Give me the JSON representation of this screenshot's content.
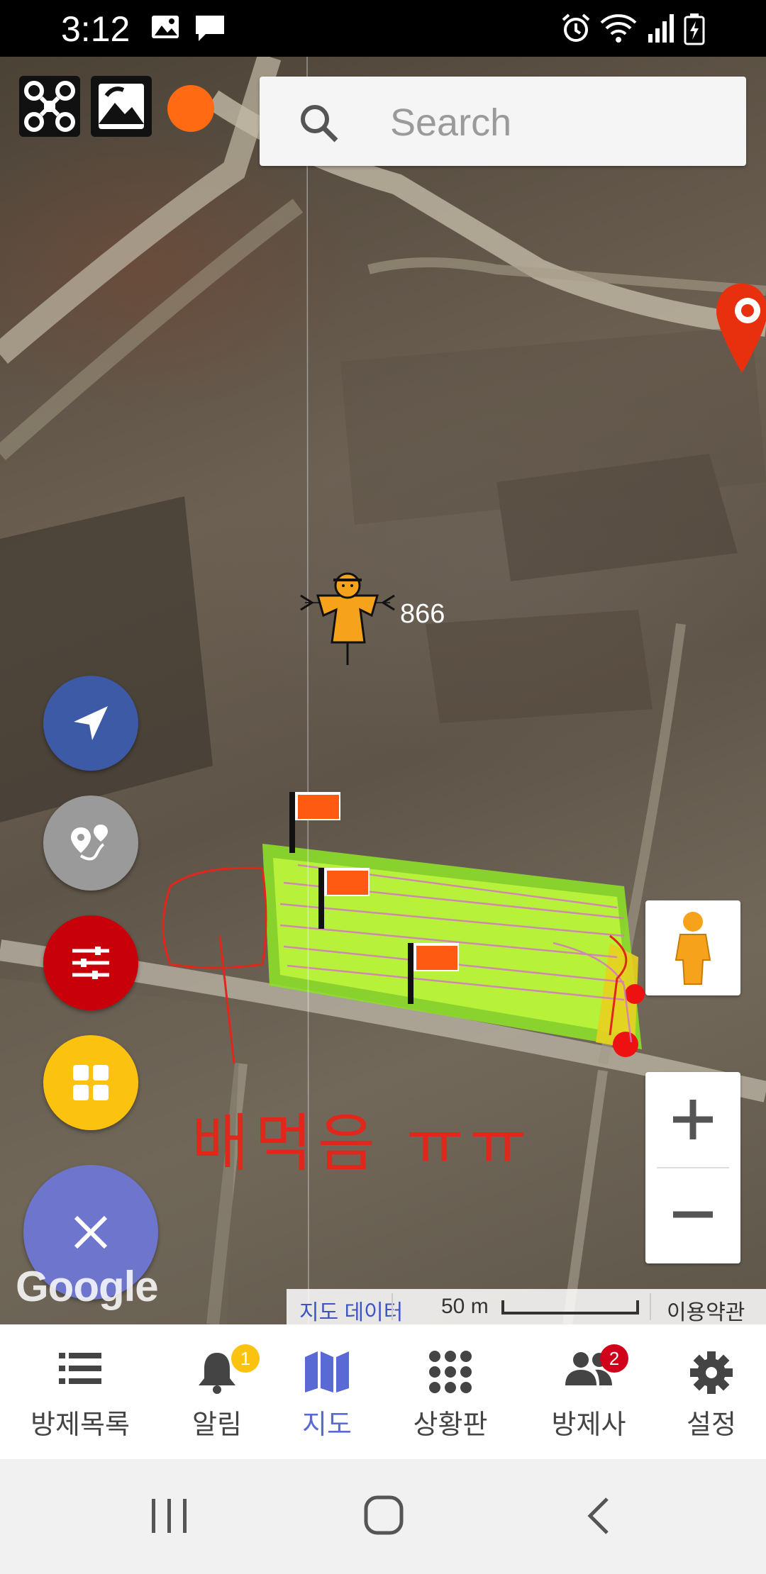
{
  "status": {
    "time": "3:12"
  },
  "search": {
    "placeholder": "Search"
  },
  "map": {
    "marker_value": "866",
    "handwritten_note": "배먹음 ㅠㅠ",
    "attribution": "Google",
    "map_data_label": "지도 데이터",
    "scale_label": "50 m",
    "terms_label": "이용약관",
    "status_dot_color": "#ff6a13"
  },
  "bottom_nav": {
    "items": [
      {
        "label": "방제목록",
        "icon": "list-icon"
      },
      {
        "label": "알림",
        "icon": "bell-icon",
        "badge": "1"
      },
      {
        "label": "지도",
        "icon": "map-icon",
        "active": true
      },
      {
        "label": "상황판",
        "icon": "grid-dots-icon"
      },
      {
        "label": "방제사",
        "icon": "people-icon",
        "badge": "2"
      },
      {
        "label": "설정",
        "icon": "gear-icon"
      }
    ]
  },
  "colors": {
    "accent": "#5a6ad4",
    "fab_nav": "#3c5aa6",
    "fab_route": "#9a9a9a",
    "fab_filter": "#c8000a",
    "fab_grid": "#fbc30f",
    "fab_close": "#6e75cc"
  }
}
